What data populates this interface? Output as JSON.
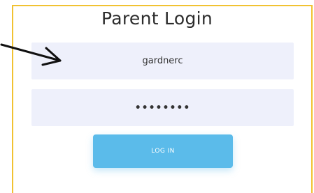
{
  "header": {
    "title": "Parent Login"
  },
  "form": {
    "username_value": "gardnerc",
    "password_value": "••••••••",
    "login_label": "LOG IN"
  },
  "colors": {
    "panel_border": "#f1c232",
    "field_bg": "#eef0fb",
    "button_bg": "#5bbbea",
    "arrow": "#111111"
  },
  "annotation": {
    "icon": "arrow-icon"
  }
}
